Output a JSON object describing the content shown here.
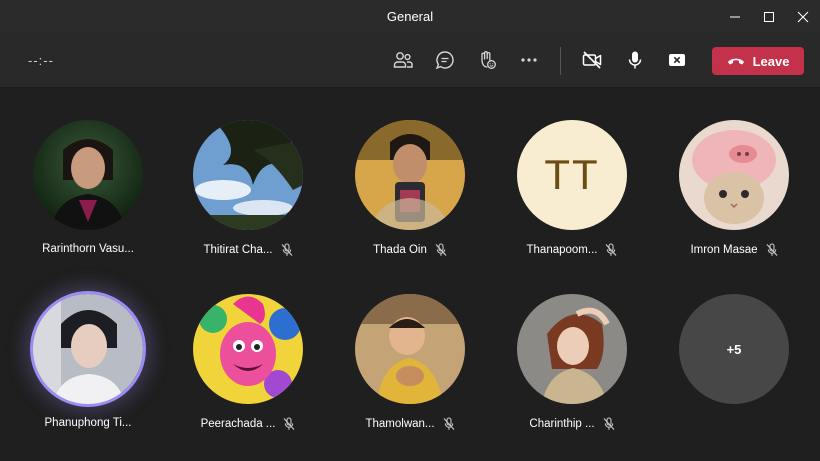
{
  "window": {
    "title": "General"
  },
  "toolbar": {
    "timer": "--:--",
    "leave_label": "Leave",
    "colors": {
      "leave": "#c4314b"
    }
  },
  "participants": [
    {
      "name": "Rarinthorn Vasu...",
      "muted": false,
      "avatar": "photo"
    },
    {
      "name": "Thitirat Cha...",
      "muted": true,
      "avatar": "photo"
    },
    {
      "name": "Thada Oin",
      "muted": true,
      "avatar": "photo"
    },
    {
      "name": "Thanapoom...",
      "muted": true,
      "avatar": "initials",
      "initials": "TT"
    },
    {
      "name": "Imron Masae",
      "muted": true,
      "avatar": "photo"
    },
    {
      "name": "Phanuphong Ti...",
      "muted": false,
      "avatar": "photo",
      "speaking": true
    },
    {
      "name": "Peerachada ...",
      "muted": true,
      "avatar": "photo"
    },
    {
      "name": "Thamolwan...",
      "muted": true,
      "avatar": "photo"
    },
    {
      "name": "Charinthip ...",
      "muted": true,
      "avatar": "photo"
    }
  ],
  "overflow": {
    "label": "+5"
  }
}
